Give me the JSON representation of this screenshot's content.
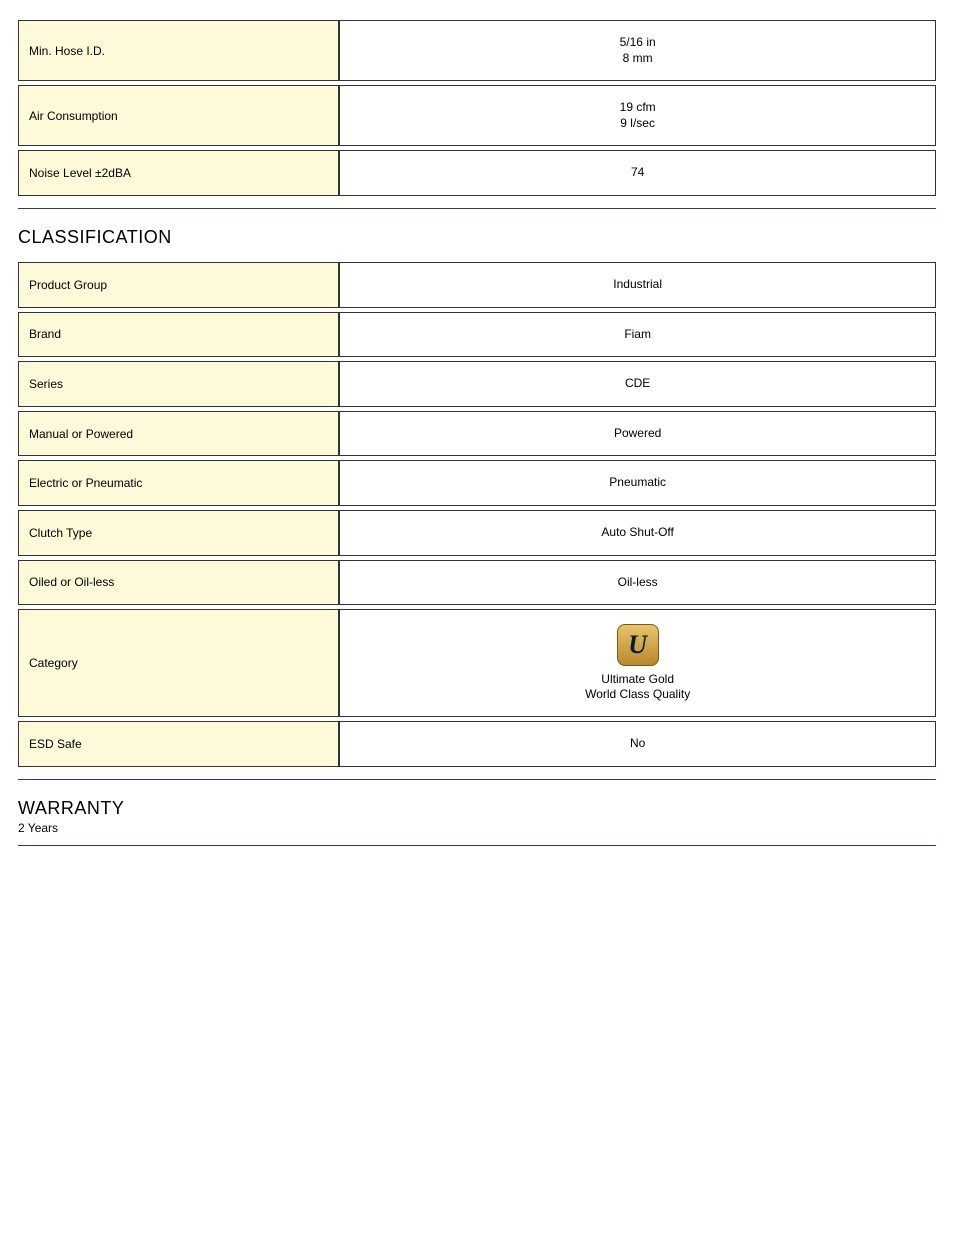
{
  "top_table": [
    {
      "label": "Min. Hose I.D.",
      "value": "5/16 in\n8 mm"
    },
    {
      "label": "Air Consumption",
      "value": "19 cfm\n9 l/sec"
    },
    {
      "label": "Noise Level ±2dBA",
      "value": "74"
    }
  ],
  "classification": {
    "title": "CLASSIFICATION",
    "rows": [
      {
        "label": "Product Group",
        "value": "Industrial"
      },
      {
        "label": "Brand",
        "value": "Fiam"
      },
      {
        "label": "Series",
        "value": "CDE"
      },
      {
        "label": "Manual or Powered",
        "value": "Powered"
      },
      {
        "label": "Electric or Pneumatic",
        "value": "Pneumatic"
      },
      {
        "label": "Clutch Type",
        "value": "Auto Shut-Off"
      },
      {
        "label": "Oiled or Oil-less",
        "value": "Oil-less"
      }
    ],
    "category_label": "Category",
    "category_badge_letter": "U",
    "category_caption_line1": "Ultimate Gold",
    "category_caption_line2": "World Class Quality",
    "esd_label": "ESD Safe",
    "esd_value": "No"
  },
  "warranty": {
    "title": "WARRANTY",
    "value": "2 Years"
  }
}
